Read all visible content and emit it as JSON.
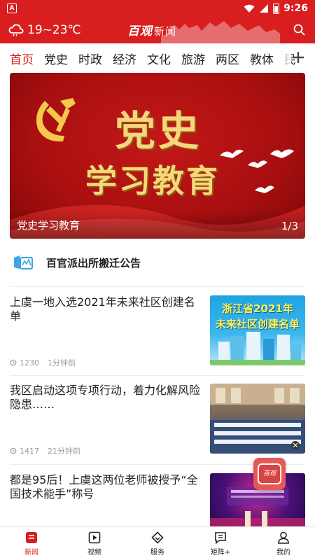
{
  "status_bar": {
    "left_icon": "A",
    "time": "9:26",
    "icons": [
      "wifi-icon",
      "signal-icon",
      "battery-icon"
    ]
  },
  "header": {
    "weather_icon": "cloud-icon",
    "temperature": "19~23℃",
    "logo_text": "百观",
    "logo_sub": "新闻",
    "search_icon": "search-icon",
    "bg_color": "#d81e1e"
  },
  "tabs": [
    "首页",
    "党史",
    "时政",
    "经济",
    "文化",
    "旅游",
    "两区",
    "教体",
    "民"
  ],
  "active_tab": "首页",
  "banner": {
    "title_line1": "党史",
    "title_line2": "学习教育",
    "caption": "党史学习教育",
    "page": "1/3"
  },
  "notice": {
    "icon": "notice-icon",
    "text": "百官派出所搬迁公告"
  },
  "news": [
    {
      "title": "上虞一地入选2021年未来社区创建名单",
      "views": "1230",
      "time": "1分钟前",
      "thumb_line1": "浙江省2021年",
      "thumb_line2": "未来社区创建名单"
    },
    {
      "title": "我区启动这项专项行动，着力化解风险隐患……",
      "views": "1417",
      "time": "21分钟前"
    },
    {
      "title": "都是95后！上虞这两位老师被授予“全国技术能手”称号"
    }
  ],
  "float_button": {
    "line1": "百观",
    "line2": ""
  },
  "bottom_nav": [
    {
      "label": "新闻",
      "icon": "news-icon",
      "active": true
    },
    {
      "label": "视频",
      "icon": "video-icon",
      "active": false
    },
    {
      "label": "服务",
      "icon": "service-icon",
      "active": false
    },
    {
      "label": "矩阵+",
      "icon": "matrix-icon",
      "active": false
    },
    {
      "label": "我的",
      "icon": "profile-icon",
      "active": false
    }
  ],
  "colors": {
    "accent": "#d81e1e",
    "text": "#222222",
    "meta": "#9a9a9a"
  }
}
